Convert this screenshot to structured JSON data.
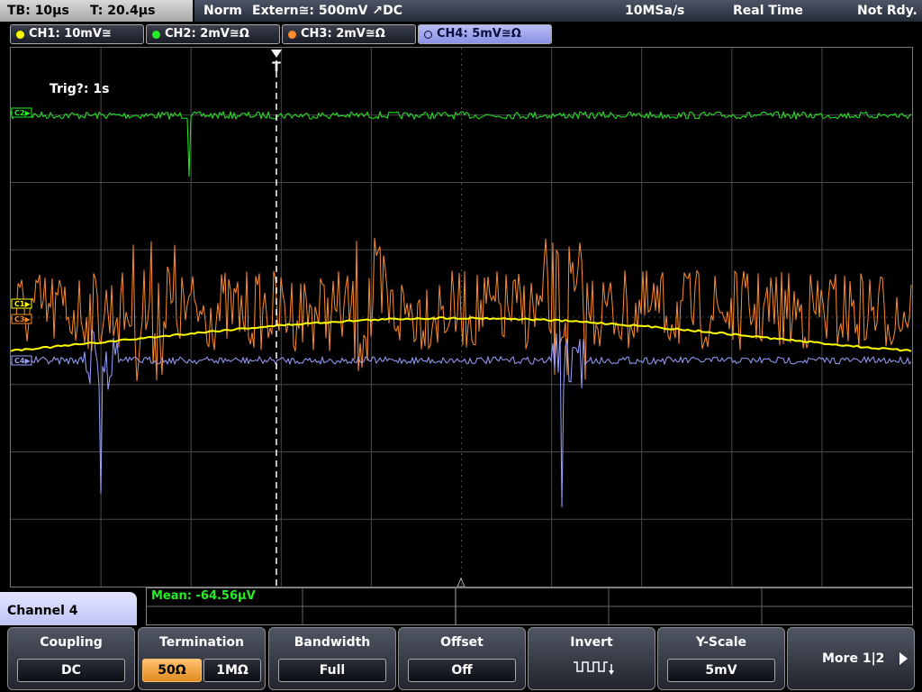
{
  "status": {
    "timebase": "TB: 10µs",
    "trigger_time": "T: 20.4µs",
    "mode": "Norm",
    "trigger_source": "Extern≅: 500mV ↗DC",
    "sample_rate": "10MSa/s",
    "acq_mode": "Real Time",
    "state": "Not Rdy."
  },
  "channels": [
    {
      "label": "CH1: 10mV≅",
      "color": "#ffff00",
      "active": false
    },
    {
      "label": "CH2: 2mV≅Ω",
      "color": "#22ee22",
      "active": false
    },
    {
      "label": "CH3: 2mV≅Ω",
      "color": "#ff8c28",
      "active": false
    },
    {
      "label": "CH4: 5mV≅Ω",
      "color": "#9aa0ff",
      "active": true
    }
  ],
  "screen": {
    "trig_text": "Trig?: 1s",
    "trigger_marker": "T",
    "marker_c2": "C2▶",
    "marker_c1": "C1▶",
    "marker_c3": "C3▶",
    "marker_c4": "C4▶"
  },
  "measurement": {
    "label": "Mean: -64.56µV"
  },
  "menu": {
    "title": "Channel 4",
    "coupling": {
      "title": "Coupling",
      "value": "DC"
    },
    "termination": {
      "title": "Termination",
      "options": [
        "50Ω",
        "1MΩ"
      ],
      "selected": "50Ω"
    },
    "bandwidth": {
      "title": "Bandwidth",
      "value": "Full"
    },
    "offset": {
      "title": "Offset",
      "value": "Off"
    },
    "invert": {
      "title": "Invert",
      "icon": "inverted-square-wave-icon"
    },
    "yscale": {
      "title": "Y-Scale",
      "value": "5mV"
    },
    "more": {
      "label": "More 1|2",
      "icon": "arrow-right-icon"
    }
  },
  "colors": {
    "ch1": "#ffff00",
    "ch2": "#22ee22",
    "ch3": "#ff8c28",
    "ch4": "#9aa0ff",
    "grid": "#4a4a4a",
    "accent": "#ffb050"
  }
}
